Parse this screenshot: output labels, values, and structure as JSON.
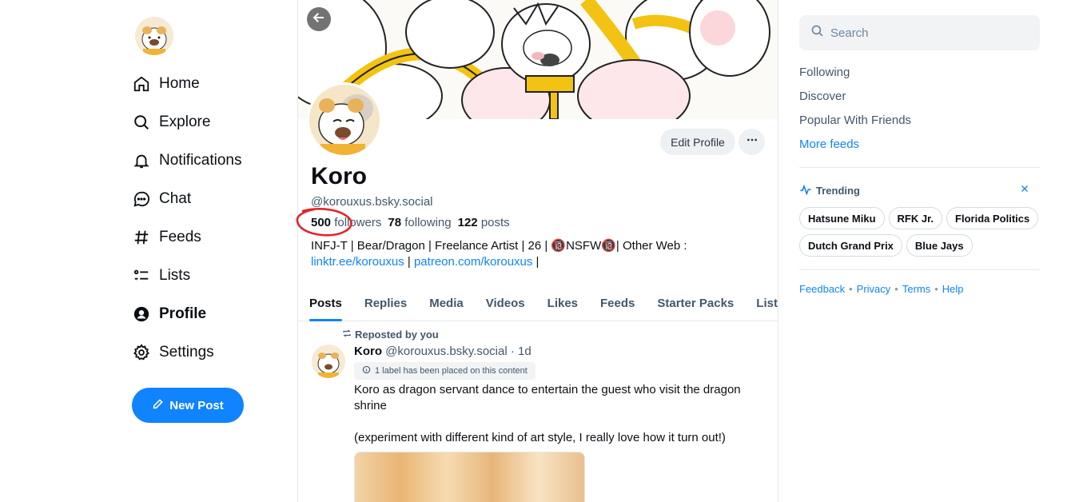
{
  "nav": {
    "items": [
      {
        "label": "Home",
        "icon": "home-icon"
      },
      {
        "label": "Explore",
        "icon": "search-icon"
      },
      {
        "label": "Notifications",
        "icon": "bell-icon"
      },
      {
        "label": "Chat",
        "icon": "chat-icon"
      },
      {
        "label": "Feeds",
        "icon": "hash-icon"
      },
      {
        "label": "Lists",
        "icon": "list-icon"
      },
      {
        "label": "Profile",
        "icon": "user-icon"
      },
      {
        "label": "Settings",
        "icon": "gear-icon"
      }
    ],
    "active": "Profile",
    "new_post_label": "New Post"
  },
  "profile": {
    "edit_label": "Edit Profile",
    "display_name": "Koro",
    "handle": "@korouxus.bsky.social",
    "followers_count": "500",
    "followers_label": "followers",
    "following_count": "78",
    "following_label": "following",
    "posts_count": "122",
    "posts_label": "posts",
    "bio_line1": "INFJ-T | Bear/Dragon |  Freelance Artist | 26 | 🔞NSFW🔞| Other Web :",
    "bio_link1": "linktr.ee/korouxus",
    "bio_sep": " | ",
    "bio_link2": "patreon.com/korouxus",
    "bio_end": " |"
  },
  "tabs": [
    "Posts",
    "Replies",
    "Media",
    "Videos",
    "Likes",
    "Feeds",
    "Starter Packs",
    "Lists"
  ],
  "active_tab": "Posts",
  "post": {
    "repost_label": "Reposted by you",
    "author_name": "Koro",
    "author_handle": "@korouxus.bsky.social",
    "time": " · 1d",
    "label_notice": "1 label has been placed on this content",
    "text": "Koro as dragon servant dance to entertain the guest who visit the dragon shrine\n\n(experiment with different kind of art style, I really love how it turn out!)"
  },
  "right": {
    "search_placeholder": "Search",
    "feeds": [
      "Following",
      "Discover",
      "Popular With Friends"
    ],
    "more_feeds": "More feeds",
    "trending_title": "Trending",
    "trending": [
      "Hatsune Miku",
      "RFK Jr.",
      "Florida Politics",
      "Dutch Grand Prix",
      "Blue Jays"
    ],
    "footer": [
      "Feedback",
      "Privacy",
      "Terms",
      "Help"
    ]
  },
  "colors": {
    "accent": "#1083fe",
    "annotation": "#e0242c"
  }
}
